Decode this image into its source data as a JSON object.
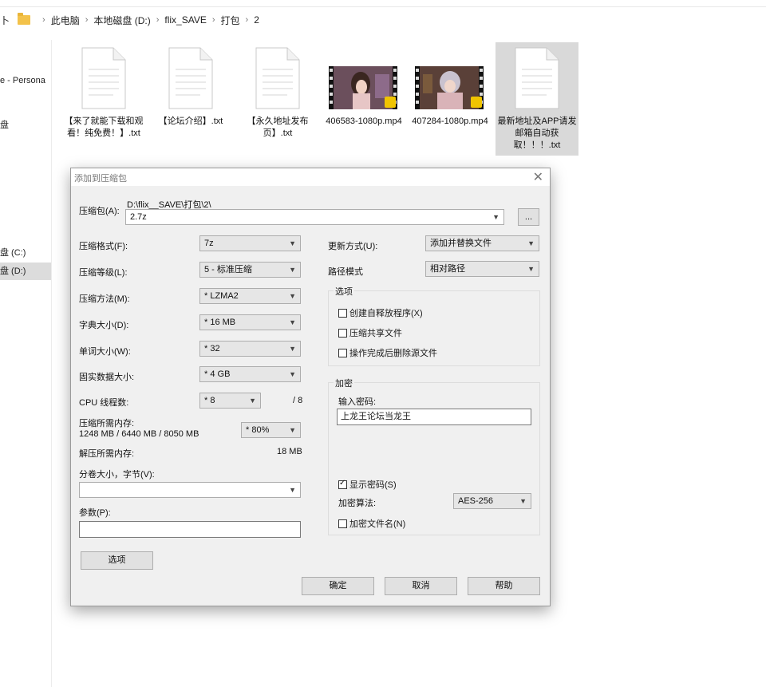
{
  "explorer": {
    "breadcrumb": [
      "此电脑",
      "本地磁盘 (D:)",
      "flix_SAVE",
      "打包",
      "2"
    ],
    "nav_glyph": "卜",
    "sidebar": [
      "e - Persona",
      "盘",
      "盘 (C:)",
      "盘 (D:)"
    ],
    "files": [
      {
        "name": "【来了就能下载和观看！纯免费！】.txt",
        "type": "txt"
      },
      {
        "name": "【论坛介绍】.txt",
        "type": "txt"
      },
      {
        "name": "【永久地址发布页】.txt",
        "type": "txt"
      },
      {
        "name": "406583-1080p.mp4",
        "type": "mp4"
      },
      {
        "name": "407284-1080p.mp4",
        "type": "mp4"
      },
      {
        "name": "最新地址及APP请发邮箱自动获取！！！.txt",
        "type": "txt",
        "selected": true
      }
    ]
  },
  "dialog": {
    "title": "添加到压缩包",
    "close": "✕",
    "archive": {
      "label": "压缩包(A):",
      "path": "D:\\flix__SAVE\\打包\\2\\",
      "value": "2.7z",
      "browse": "..."
    },
    "left": {
      "format": {
        "label": "压缩格式(F):",
        "value": "7z"
      },
      "level": {
        "label": "压缩等级(L):",
        "value": "5 - 标准压缩"
      },
      "method": {
        "label": "压缩方法(M):",
        "value": "* LZMA2"
      },
      "dict": {
        "label": "字典大小(D):",
        "value": "* 16 MB"
      },
      "word": {
        "label": "单词大小(W):",
        "value": "* 32"
      },
      "solid": {
        "label": "固实数据大小:",
        "value": "* 4 GB"
      },
      "threads": {
        "label": "CPU 线程数:",
        "value": "* 8",
        "max": "/ 8"
      },
      "mem_comp": {
        "label": "压缩所需内存:",
        "detail": "1248 MB / 6440 MB / 8050 MB",
        "value": "* 80%"
      },
      "mem_decomp": {
        "label": "解压所需内存:",
        "value": "18 MB"
      },
      "split": {
        "label": "分卷大小，字节(V):",
        "value": ""
      },
      "params": {
        "label": "参数(P):",
        "value": ""
      },
      "options_button": "选项"
    },
    "right": {
      "update": {
        "label": "更新方式(U):",
        "value": "添加并替换文件"
      },
      "pathmode": {
        "label": "路径模式",
        "value": "相对路径"
      },
      "options_group": {
        "title": "选项",
        "items": [
          {
            "label": "创建自释放程序(X)",
            "checked": false
          },
          {
            "label": "压缩共享文件",
            "checked": false
          },
          {
            "label": "操作完成后删除源文件",
            "checked": false
          }
        ]
      },
      "encryption": {
        "title": "加密",
        "password_label": "输入密码:",
        "password": "上龙王论坛当龙王",
        "show_password": {
          "label": "显示密码(S)",
          "checked": true
        },
        "method_label": "加密算法:",
        "method": "AES-256",
        "encrypt_names": {
          "label": "加密文件名(N)",
          "checked": false
        }
      }
    },
    "buttons": {
      "ok": "确定",
      "cancel": "取消",
      "help": "帮助"
    }
  }
}
